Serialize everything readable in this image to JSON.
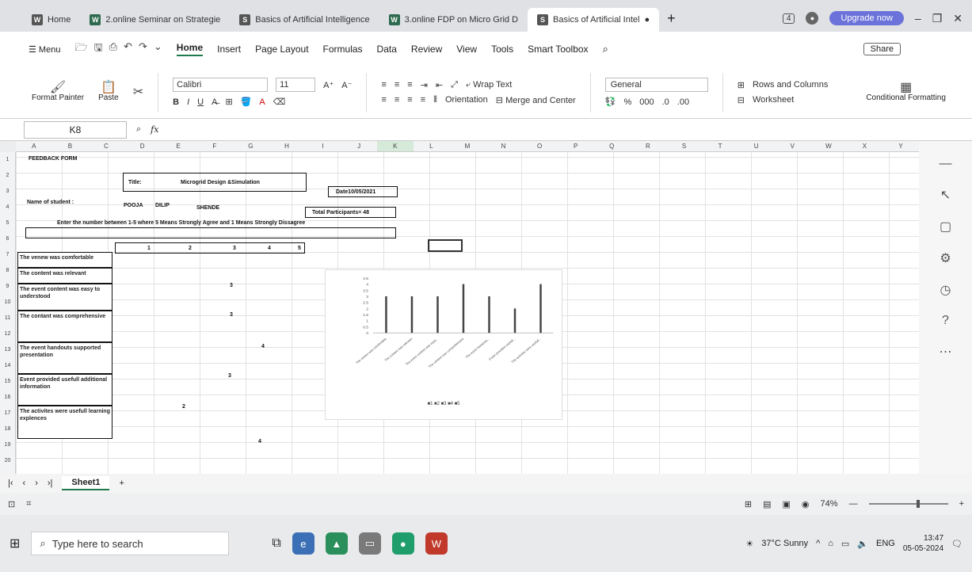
{
  "tabs": [
    {
      "label": "Home",
      "icon": "W"
    },
    {
      "label": "2.online Seminar on Strategie",
      "icon": "W"
    },
    {
      "label": "Basics of Artificial Intelligence",
      "icon": "S"
    },
    {
      "label": "3.online FDP  on Micro Grid D",
      "icon": "W"
    },
    {
      "label": "Basics of Artificial Intel",
      "icon": "S",
      "active": true
    }
  ],
  "window": {
    "badge": "4",
    "upgrade": "Upgrade now",
    "minimize": "–",
    "restore": "❐",
    "close": "✕"
  },
  "menu": {
    "menu_label": "Menu",
    "items": [
      "Home",
      "Insert",
      "Page Layout",
      "Formulas",
      "Data",
      "Review",
      "View",
      "Tools",
      "Smart Toolbox"
    ],
    "share": "Share"
  },
  "ribbon": {
    "format_painter": "Format Painter",
    "paste": "Paste",
    "font_name": "Calibri",
    "font_size": "11",
    "wrap_text": "Wrap Text",
    "orientation": "Orientation",
    "merge_center": "Merge and Center",
    "number_format": "General",
    "rows_columns": "Rows and Columns",
    "worksheet": "Worksheet",
    "conditional_formatting": "Conditional Formatting"
  },
  "formula_bar": {
    "name_box": "K8",
    "fx": "fx",
    "value": ""
  },
  "columns": [
    "A",
    "B",
    "C",
    "D",
    "E",
    "F",
    "G",
    "H",
    "I",
    "J",
    "K",
    "L",
    "M",
    "N",
    "O",
    "P",
    "Q",
    "R",
    "S",
    "T",
    "U",
    "V",
    "W",
    "X",
    "Y"
  ],
  "rows": [
    "1",
    "2",
    "3",
    "4",
    "5",
    "6",
    "7",
    "8",
    "9",
    "10",
    "11",
    "12",
    "13",
    "14",
    "15",
    "16",
    "17",
    "18",
    "19",
    "20"
  ],
  "sheet": {
    "form_title": "FEEDBACK FORM",
    "title_label": "Title:",
    "title_value": "Microgrid Design &Simulation",
    "date": "Date10/05/2021",
    "name_label": "Name of student :",
    "name_first": "POOJA",
    "name_middle": "DILIP",
    "name_last": "SHENDE",
    "participants": "Total Participants= 48",
    "instruction": "Enter the number between 1-5 where 5 Means Strongly Agree and 1 Means Strongly Dissagree",
    "scale": [
      "1",
      "2",
      "3",
      "4",
      "5"
    ],
    "questions": [
      {
        "text": "The venew was comfortable",
        "answer": ""
      },
      {
        "text": "The content was relevant",
        "answer": ""
      },
      {
        "text": "The event content was easy to understood",
        "answer": "3"
      },
      {
        "text": "The contant was comprehensive",
        "answer": "3"
      },
      {
        "text": "The event handouts supported presentation",
        "answer": "4"
      },
      {
        "text": "Event provided usefull additional information",
        "answer": "3"
      },
      {
        "text": "The activites were usefull learning explences",
        "answer": "2"
      }
    ],
    "extra_answer": "4"
  },
  "chart_data": {
    "type": "bar",
    "categories": [
      "The venew was comfortable",
      "The content was relevant",
      "The event content was easy...",
      "The contant was comprehensive",
      "The event handouts...",
      "Event provided usefull...",
      "The activites were usefull..."
    ],
    "values": [
      3,
      3,
      3,
      4,
      3,
      2,
      4
    ],
    "y_ticks": [
      "4.5",
      "4",
      "3.5",
      "3",
      "2.5",
      "2",
      "1.5",
      "1",
      "0.5",
      "0"
    ],
    "ylim": [
      0,
      4.5
    ],
    "legend": "■1 ■2 ■3 ■4 ■5"
  },
  "sheet_tabs": {
    "active": "Sheet1",
    "add": "+"
  },
  "status": {
    "zoom": "74%"
  },
  "taskbar": {
    "search_placeholder": "Type here to search",
    "weather": "37°C  Sunny",
    "lang": "ENG",
    "time": "13:47",
    "date": "05-05-2024"
  }
}
